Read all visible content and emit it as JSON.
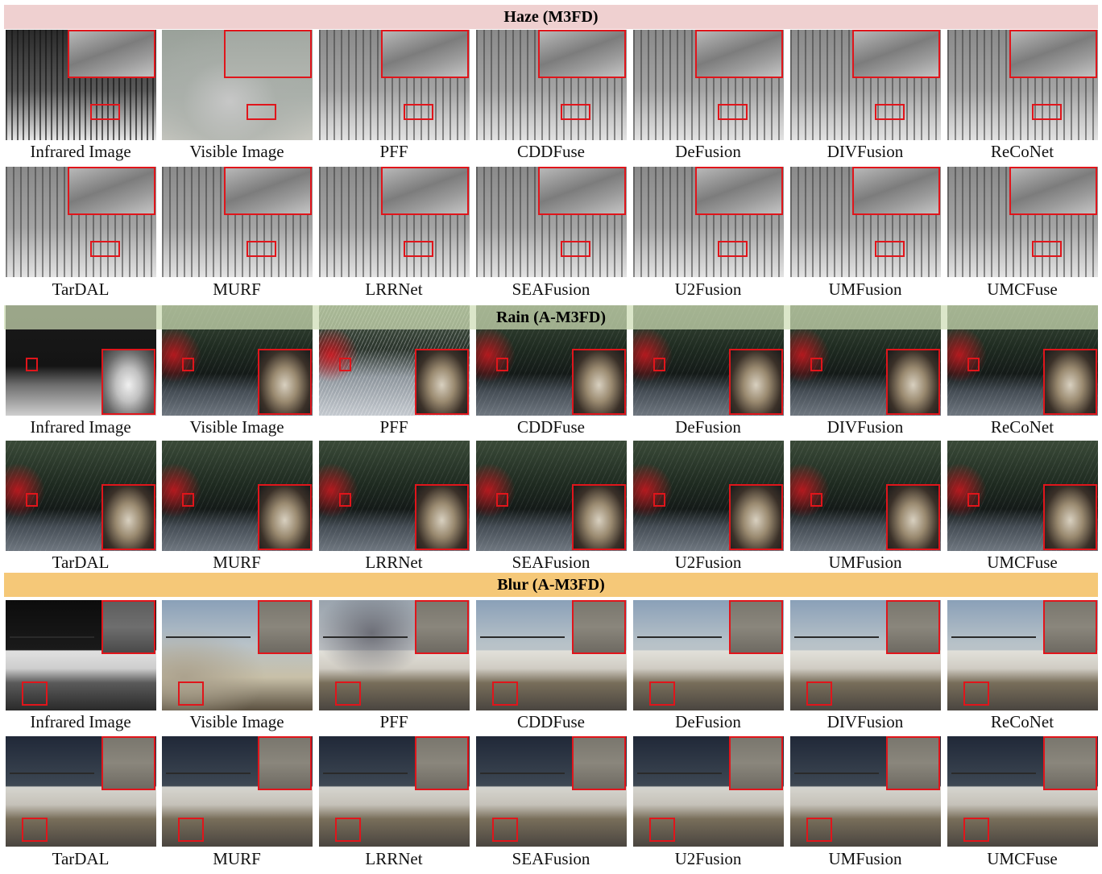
{
  "sections": [
    {
      "title": "Haze (M3FD)",
      "rows": [
        [
          "Infrared Image",
          "Visible Image",
          "PFF",
          "CDDFuse",
          "DeFusion",
          "DIVFusion",
          "ReCoNet"
        ],
        [
          "TarDAL",
          "MURF",
          "LRRNet",
          "SEAFusion",
          "U2Fusion",
          "UMFusion",
          "UMCFuse"
        ]
      ]
    },
    {
      "title": "Rain (A-M3FD)",
      "rows": [
        [
          "Infrared Image",
          "Visible Image",
          "PFF",
          "CDDFuse",
          "DeFusion",
          "DIVFusion",
          "ReCoNet"
        ],
        [
          "TarDAL",
          "MURF",
          "LRRNet",
          "SEAFusion",
          "U2Fusion",
          "UMFusion",
          "UMCFuse"
        ]
      ]
    },
    {
      "title": "Blur (A-M3FD)",
      "rows": [
        [
          "Infrared Image",
          "Visible Image",
          "PFF",
          "CDDFuse",
          "DeFusion",
          "DIVFusion",
          "ReCoNet"
        ],
        [
          "TarDAL",
          "MURF",
          "LRRNet",
          "SEAFusion",
          "U2Fusion",
          "UMFusion",
          "UMCFuse"
        ]
      ]
    }
  ],
  "colors": {
    "highlight_box": "#e0151b",
    "haze_banner": "#efd0d0",
    "rain_banner": "#cddcb4",
    "blur_banner": "#f5c878"
  }
}
